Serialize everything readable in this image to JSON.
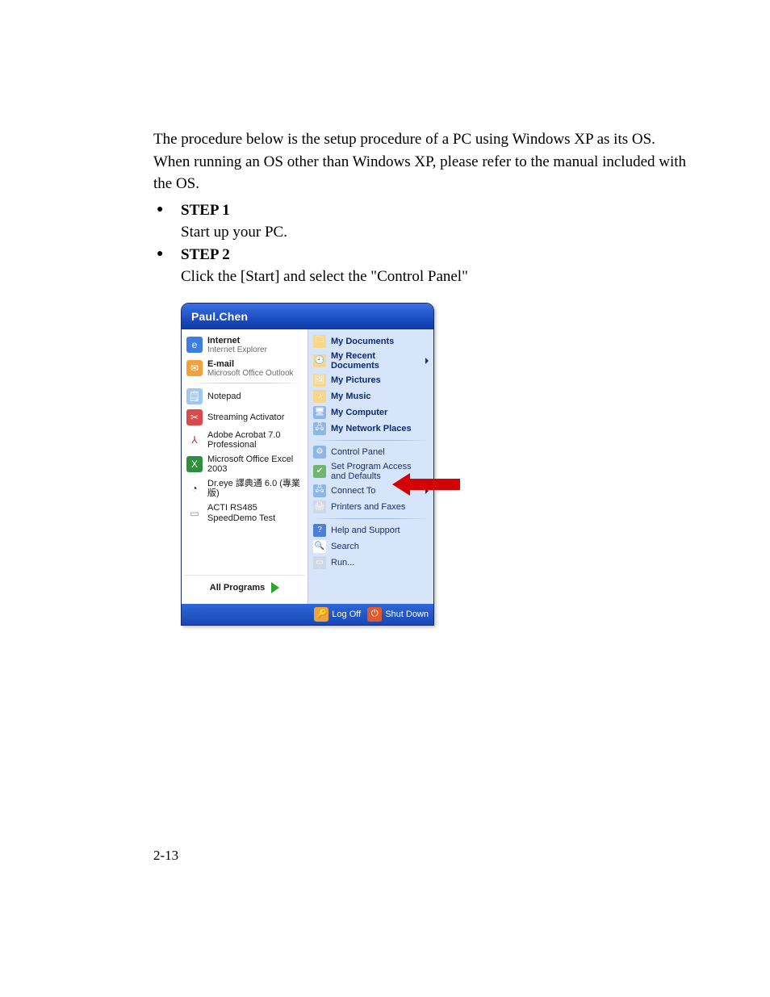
{
  "intro": "The procedure below is the setup procedure of a PC using Windows XP as its OS. When running an OS other than Windows XP, please refer to the manual included with the OS.",
  "steps": [
    {
      "head": "STEP 1",
      "body": "Start up your PC."
    },
    {
      "head": "STEP 2",
      "body": "Click the [Start] and select the \"Control Panel\""
    }
  ],
  "start_menu": {
    "user": "Paul.Chen",
    "left_pinned": [
      {
        "title": "Internet",
        "subtitle": "Internet Explorer",
        "icon": "ie-icon",
        "icon_bg": "#3b7ee0",
        "icon_glyph": "e"
      },
      {
        "title": "E-mail",
        "subtitle": "Microsoft Office Outlook",
        "icon": "outlook-icon",
        "icon_bg": "#f2a23a",
        "icon_glyph": "✉"
      }
    ],
    "left_recent": [
      {
        "title": "Notepad",
        "icon": "notepad-icon",
        "icon_bg": "#9fc7ef",
        "icon_glyph": "🗒"
      },
      {
        "title": "Streaming Activator",
        "icon": "activator-icon",
        "icon_bg": "#d94b4b",
        "icon_glyph": "✂"
      },
      {
        "title": "Adobe Acrobat 7.0 Professional",
        "icon": "acrobat-icon",
        "icon_bg": "#ffffff",
        "icon_fg": "#c1272d",
        "icon_glyph": "⅄"
      },
      {
        "title": "Microsoft Office Excel 2003",
        "icon": "excel-icon",
        "icon_bg": "#2f8f3f",
        "icon_glyph": "X"
      },
      {
        "title": "Dr.eye 譯典通 6.0 (專業版)",
        "icon": "dreye-icon",
        "icon_bg": "#ffffff",
        "icon_fg": "#1a1a1a",
        "icon_glyph": "◔"
      },
      {
        "title": "ACTI RS485 SpeedDemo Test",
        "icon": "acti-icon",
        "icon_bg": "#ffffff",
        "icon_fg": "#8a8a8a",
        "icon_glyph": "▭"
      }
    ],
    "all_programs": "All Programs",
    "right_top": [
      {
        "title": "My Documents",
        "bold": true,
        "icon": "mydocs-icon",
        "icon_bg": "#f7d88a",
        "icon_glyph": "🗀"
      },
      {
        "title": "My Recent Documents",
        "bold": true,
        "submenu": true,
        "icon": "recent-icon",
        "icon_bg": "#f7d88a",
        "icon_glyph": "🕘"
      },
      {
        "title": "My Pictures",
        "bold": true,
        "icon": "mypics-icon",
        "icon_bg": "#f7d88a",
        "icon_glyph": "🖼"
      },
      {
        "title": "My Music",
        "bold": true,
        "icon": "mymusic-icon",
        "icon_bg": "#f7d88a",
        "icon_glyph": "♪"
      },
      {
        "title": "My Computer",
        "bold": true,
        "icon": "mycomp-icon",
        "icon_bg": "#8fb7e6",
        "icon_glyph": "🖥"
      },
      {
        "title": "My Network Places",
        "bold": true,
        "icon": "mynet-icon",
        "icon_bg": "#8fb7e6",
        "icon_glyph": "🖧"
      }
    ],
    "right_mid": [
      {
        "title": "Control Panel",
        "icon": "control-panel-icon",
        "icon_bg": "#8fb7e6",
        "icon_glyph": "⚙"
      },
      {
        "title": "Set Program Access and Defaults",
        "icon": "spad-icon",
        "icon_bg": "#6fb76f",
        "icon_glyph": "✔"
      },
      {
        "title": "Connect To",
        "submenu": true,
        "icon": "connect-icon",
        "icon_bg": "#8fb7e6",
        "icon_glyph": "🖧"
      },
      {
        "title": "Printers and Faxes",
        "icon": "printers-icon",
        "icon_bg": "#cfd9e6",
        "icon_glyph": "🖨"
      }
    ],
    "right_bot": [
      {
        "title": "Help and Support",
        "icon": "help-icon",
        "icon_bg": "#4d7fd6",
        "icon_glyph": "?"
      },
      {
        "title": "Search",
        "icon": "search-icon",
        "icon_bg": "#ffffff",
        "icon_fg": "#555",
        "icon_glyph": "🔍"
      },
      {
        "title": "Run...",
        "icon": "run-icon",
        "icon_bg": "#cfd9e6",
        "icon_glyph": "▭"
      }
    ],
    "footer": {
      "logoff": "Log Off",
      "shutdown": "Shut Down"
    }
  },
  "page_number": "2-13"
}
